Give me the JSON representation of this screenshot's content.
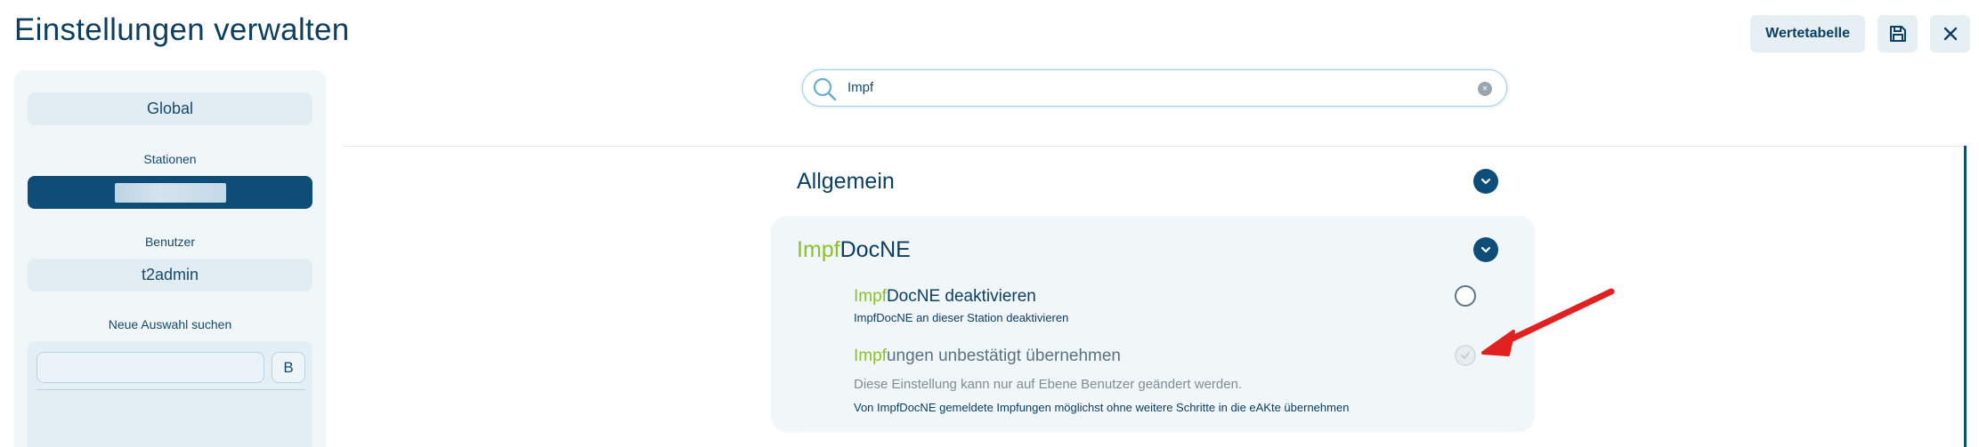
{
  "header": {
    "title": "Einstellungen verwalten",
    "wertetabelle_label": "Wertetabelle",
    "save_icon": "save-icon",
    "close_icon": "close-icon"
  },
  "left_panel": {
    "global_label": "Global",
    "stationen_label": "Stationen",
    "benutzer_label": "Benutzer",
    "benutzer_value": "t2admin",
    "neue_auswahl_label": "Neue Auswahl suchen",
    "search_value": "",
    "b_button_label": "B"
  },
  "search": {
    "value": "Impf",
    "icon": "search-icon"
  },
  "categories": {
    "allgemein": {
      "title": "Allgemein"
    },
    "impfdocne": {
      "title_highlight": "Impf",
      "title_rest": "DocNE",
      "settings": [
        {
          "title_highlight": "Impf",
          "title_rest": "DocNE deaktivieren",
          "description": "ImpfDocNE an dieser Station deaktivieren"
        },
        {
          "title_highlight": "Impf",
          "title_rest": "ungen unbestätigt übernehmen",
          "note": "Diese Einstellung kann nur auf Ebene Benutzer geändert werden.",
          "description": "Von ImpfDocNE gemeldete Impfungen möglichst ohne weitere Schritte in die eAKte übernehmen"
        }
      ]
    }
  },
  "colors": {
    "brand_dark": "#0e4d77",
    "highlight_green": "#8dbf2e",
    "annotation_red": "#e0211f"
  }
}
